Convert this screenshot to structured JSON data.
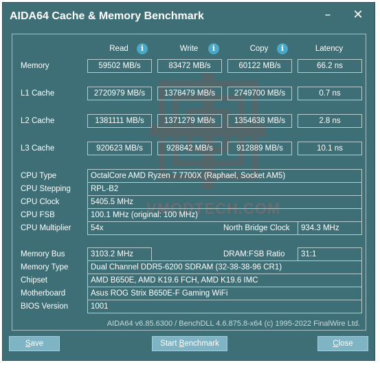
{
  "window": {
    "title": "AIDA64 Cache & Memory Benchmark",
    "minimize_label": "–",
    "close_label": "✕"
  },
  "columns": {
    "read": "Read",
    "write": "Write",
    "copy": "Copy",
    "latency": "Latency",
    "info_glyph": "i"
  },
  "rows": {
    "memory": {
      "label": "Memory",
      "read": "59502 MB/s",
      "write": "83472 MB/s",
      "copy": "60122 MB/s",
      "latency": "66.2 ns"
    },
    "l1": {
      "label": "L1 Cache",
      "read": "2720979 MB/s",
      "write": "1378479 MB/s",
      "copy": "2749700 MB/s",
      "latency": "0.7 ns"
    },
    "l2": {
      "label": "L2 Cache",
      "read": "1381111 MB/s",
      "write": "1371279 MB/s",
      "copy": "1354638 MB/s",
      "latency": "2.8 ns"
    },
    "l3": {
      "label": "L3 Cache",
      "read": "920623 MB/s",
      "write": "928842 MB/s",
      "copy": "912889 MB/s",
      "latency": "10.1 ns"
    }
  },
  "info": {
    "cpu_type": {
      "label": "CPU Type",
      "value": "OctalCore AMD Ryzen 7 7700X  (Raphael, Socket AM5)"
    },
    "cpu_stepping": {
      "label": "CPU Stepping",
      "value": "RPL-B2"
    },
    "cpu_clock": {
      "label": "CPU Clock",
      "value": "5405.5 MHz"
    },
    "cpu_fsb": {
      "label": "CPU FSB",
      "value": "100.1 MHz  (original: 100 MHz)"
    },
    "cpu_multiplier": {
      "label": "CPU Multiplier",
      "value": "54x"
    },
    "north_bridge_clock": {
      "label": "North Bridge Clock",
      "value": "934.3 MHz"
    },
    "memory_bus": {
      "label": "Memory Bus",
      "value": "3103.2 MHz"
    },
    "dram_fsb_ratio": {
      "label": "DRAM:FSB Ratio",
      "value": "31:1"
    },
    "memory_type": {
      "label": "Memory Type",
      "value": "Dual Channel DDR5-6200 SDRAM  (32-38-38-96 CR1)"
    },
    "chipset": {
      "label": "Chipset",
      "value": "AMD B650E, AMD K19.6 FCH, AMD K19.6 IMC"
    },
    "motherboard": {
      "label": "Motherboard",
      "value": "Asus ROG Strix B650E-F Gaming WiFi"
    },
    "bios_version": {
      "label": "BIOS Version",
      "value": "1001"
    }
  },
  "watermark_text": "VMODTECH.COM",
  "footer": "AIDA64 v6.85.6300 / BenchDLL 4.6.875.8-x64  (c) 1995-2022 FinalWire Ltd.",
  "buttons": {
    "save_first": "S",
    "save_rest": "ave",
    "start_pre": "Start ",
    "start_u": "B",
    "start_rest": "enchmark",
    "close_first": "C",
    "close_rest": "lose"
  },
  "colors": {
    "window_bg": "#3e6f76",
    "button_bg": "#7fb4c4",
    "info_icon": "#4aa8c8"
  }
}
